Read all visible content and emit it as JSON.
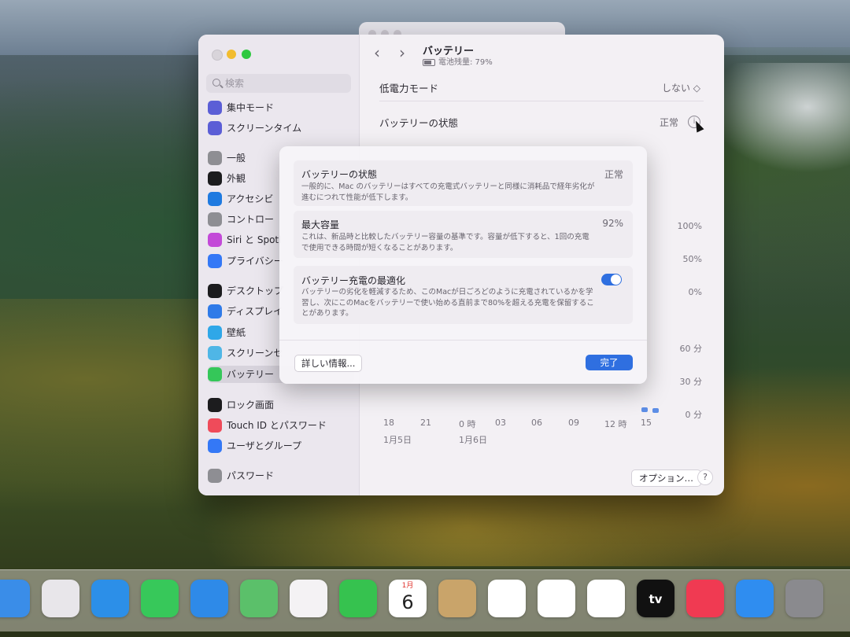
{
  "window": {
    "pane_title": "バッテリー",
    "pane_subtitle": "電池残量: 79%",
    "nav_back": "‹",
    "nav_forward": "›"
  },
  "sidebar": {
    "search_placeholder": "検索",
    "items": [
      {
        "label": "集中モード",
        "icon": "moon-icon",
        "color": "#5b5ed6"
      },
      {
        "label": "スクリーンタイム",
        "icon": "hourglass-icon",
        "color": "#5b5ed6"
      },
      {
        "label": "一般",
        "icon": "gear-icon",
        "color": "#8e8e93"
      },
      {
        "label": "外観",
        "icon": "appearance-icon",
        "color": "#1c1c1e"
      },
      {
        "label": "アクセシビ",
        "icon": "accessibility-icon",
        "color": "#1f7ae0"
      },
      {
        "label": "コントロー",
        "icon": "control-center-icon",
        "color": "#8e8e93"
      },
      {
        "label": "Siri と Spotl",
        "icon": "siri-icon",
        "color": "#c34ad8"
      },
      {
        "label": "プライバシー",
        "icon": "hand-icon",
        "color": "#3478f6"
      },
      {
        "label": "デスクトップ",
        "icon": "desktop-icon",
        "color": "#1c1c1e"
      },
      {
        "label": "ディスプレイ",
        "icon": "display-icon",
        "color": "#2f7ae8"
      },
      {
        "label": "壁紙",
        "icon": "wallpaper-icon",
        "color": "#2fa7e8"
      },
      {
        "label": "スクリーンセ",
        "icon": "screensaver-icon",
        "color": "#4fb6e6"
      },
      {
        "label": "バッテリー",
        "icon": "battery-icon",
        "color": "#35c759"
      },
      {
        "label": "ロック画面",
        "icon": "lock-icon",
        "color": "#1c1c1e"
      },
      {
        "label": "Touch ID とパスワード",
        "icon": "fingerprint-icon",
        "color": "#ef4b5a"
      },
      {
        "label": "ユーザとグループ",
        "icon": "users-icon",
        "color": "#3478f6"
      },
      {
        "label": "パスワード",
        "icon": "key-icon",
        "color": "#8e8e93"
      }
    ]
  },
  "settings": {
    "low_power_label": "低電力モード",
    "low_power_value": "しない ◇",
    "health_label": "バッテリーの状態",
    "health_value": "正常",
    "info_glyph": "i"
  },
  "chart": {
    "level_labels": [
      "100%",
      "50%",
      "0%"
    ],
    "time_labels": [
      "60 分",
      "30 分",
      "0 分"
    ],
    "x_ticks": [
      "18",
      "21",
      "0 時",
      "03",
      "06",
      "09",
      "12 時",
      "15"
    ],
    "date_labels": [
      "1月5日",
      "1月6日"
    ]
  },
  "footer": {
    "options_label": "オプション…",
    "help_label": "?"
  },
  "sheet": {
    "health_title": "バッテリーの状態",
    "health_value": "正常",
    "health_desc": "一般的に、Mac のバッテリーはすべての充電式バッテリーと同様に消耗品で経年劣化が進むにつれて性能が低下します。",
    "capacity_title": "最大容量",
    "capacity_value": "92%",
    "capacity_desc": "これは、新品時と比較したバッテリー容量の基準です。容量が低下すると、1回の充電で使用できる時間が短くなることがあります。",
    "optimize_title": "バッテリー充電の最適化",
    "optimize_desc": "バッテリーの劣化を軽減するため、このMacが日ごろどのように充電されているかを学習し、次にこのMacをバッテリーで使い始める直前まで80%を超える充電を保留することがあります。",
    "more_info_label": "詳しい情報...",
    "done_label": "完了"
  },
  "dock": {
    "calendar_month": "1月",
    "calendar_day": "6",
    "tv_label": "tv",
    "items": [
      {
        "name": "finder-icon",
        "color": "#3a8de8"
      },
      {
        "name": "launchpad-icon",
        "color": "#e8e6ea"
      },
      {
        "name": "safari-icon",
        "color": "#2c8fe8"
      },
      {
        "name": "messages-icon",
        "color": "#37c85a"
      },
      {
        "name": "mail-icon",
        "color": "#2e8ae8"
      },
      {
        "name": "maps-icon",
        "color": "#5bc06a"
      },
      {
        "name": "photos-icon",
        "color": "#f4f2f4"
      },
      {
        "name": "facetime-icon",
        "color": "#36c24f"
      },
      {
        "name": "calendar-icon",
        "color": "#ffffff"
      },
      {
        "name": "contacts-icon",
        "color": "#c9a46a"
      },
      {
        "name": "reminders-icon",
        "color": "#ffffff"
      },
      {
        "name": "notes-icon",
        "color": "#ffffff"
      },
      {
        "name": "freeform-icon",
        "color": "#ffffff"
      },
      {
        "name": "tv-icon",
        "color": "#111111"
      },
      {
        "name": "music-icon",
        "color": "#f03a52"
      },
      {
        "name": "app-store-icon",
        "color": "#2f8df0"
      },
      {
        "name": "system-settings-icon",
        "color": "#8a8a8e"
      }
    ]
  }
}
